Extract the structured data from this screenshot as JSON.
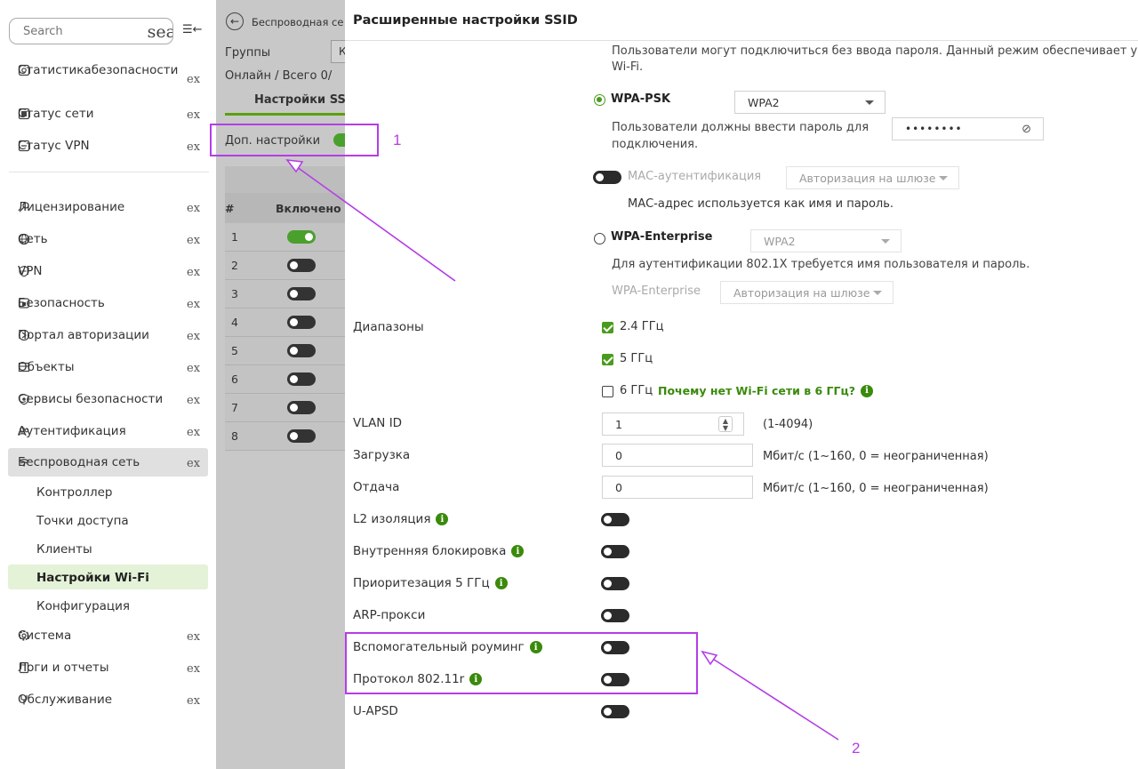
{
  "sidebar": {
    "search": {
      "placeholder": "Search",
      "value": "sea"
    },
    "collapse_icon": "collapse-left-icon",
    "ex_suffix": "ex",
    "top_items": [
      {
        "label1": "Статистика",
        "label2": "безопасности",
        "icon": "shield-stats-icon"
      },
      {
        "label": "Статус сети",
        "icon": "network-status-icon"
      },
      {
        "label": "Статус VPN",
        "icon": "vpn-status-icon"
      }
    ],
    "main_items": [
      {
        "label": "Лицензирование",
        "icon": "key-icon"
      },
      {
        "label": "Сеть",
        "icon": "globe-icon"
      },
      {
        "label": "VPN",
        "icon": "vpn-shield-icon"
      },
      {
        "label": "Безопасность",
        "icon": "lock-shield-icon"
      },
      {
        "label": "Портал авторизации",
        "icon": "portal-icon"
      },
      {
        "label": "Объекты",
        "icon": "objects-icon"
      },
      {
        "label": "Сервисы безопасности",
        "icon": "security-services-icon"
      },
      {
        "label": "Аутентификация",
        "icon": "users-icon"
      },
      {
        "label": "Беспроводная сеть",
        "icon": "wifi-icon"
      }
    ],
    "sub_items": [
      "Контроллер",
      "Точки доступа",
      "Клиенты",
      "Настройки Wi-Fi",
      "Конфигурация"
    ],
    "bottom_items": [
      {
        "label": "Система",
        "icon": "gear-icon"
      },
      {
        "label": "Логи и отчеты",
        "icon": "document-icon"
      },
      {
        "label": "Обслуживание",
        "icon": "wrench-icon"
      }
    ]
  },
  "middle": {
    "breadcrumb": "Беспроводная се",
    "groups_label": "Группы",
    "groups_value": "К",
    "online_label": "Онлайн / Всего  0/",
    "tab_label": "Настройки SSI",
    "adv_label": "Доп. настройки",
    "adv_enabled": true,
    "col_num": "#",
    "col_enabled": "Включено",
    "rows": [
      {
        "n": "1",
        "on": true
      },
      {
        "n": "2",
        "on": false
      },
      {
        "n": "3",
        "on": false
      },
      {
        "n": "4",
        "on": false
      },
      {
        "n": "5",
        "on": false
      },
      {
        "n": "6",
        "on": false
      },
      {
        "n": "7",
        "on": false
      },
      {
        "n": "8",
        "on": false
      }
    ]
  },
  "right": {
    "title": "Расширенные настройки SSID",
    "open_desc1": "Пользователи могут подключиться без ввода пароля. Данный режим обеспечивает у",
    "open_desc2": "Wi-Fi.",
    "wpa_psk_label": "WPA-PSK",
    "wpa_psk_select": "WPA2",
    "psk_desc1": "Пользователи должны ввести пароль для",
    "psk_desc2": "подключения.",
    "psk_password": "••••••••",
    "mac_label": "МАС-аутентификация",
    "mac_select": "Авторизация на шлюзе",
    "mac_desc": "МАС-адрес используется как имя и пароль.",
    "wpa_ent_label": "WPA-Enterprise",
    "wpa_ent_select": "WPA2",
    "ent_desc": "Для аутентификации 802.1X требуется имя пользователя и пароль.",
    "ent_sub_label": "WPA-Enterprise",
    "ent_sub_select": "Авторизация на шлюзе",
    "bands_label": "Диапазоны",
    "band_24": "2.4 ГГц",
    "band_5": "5 ГГц",
    "band_6": "6 ГГц",
    "band_6_link": "Почему нет Wi-Fi сети в 6 ГГц?",
    "bands_checked": {
      "b24": true,
      "b5": true,
      "b6": false
    },
    "vlan_label": "VLAN ID",
    "vlan_value": "1",
    "vlan_hint": "(1-4094)",
    "download_label": "Загрузка",
    "download_value": "0",
    "download_hint": "Мбит/с (1~160, 0 = неограниченная)",
    "upload_label": "Отдача",
    "upload_value": "0",
    "upload_hint": "Мбит/с (1~160, 0 = неограниченная)",
    "toggles": [
      {
        "label": "L2 изоляция",
        "info": true,
        "on": false
      },
      {
        "label": "Внутренняя блокировка",
        "info": true,
        "on": false
      },
      {
        "label": "Приоритезация 5 ГГц",
        "info": true,
        "on": false
      },
      {
        "label": "ARP-прокси",
        "info": false,
        "on": false
      },
      {
        "label": "Вспомогательный роуминг",
        "info": true,
        "on": false
      },
      {
        "label": "Протокол 802.11r",
        "info": true,
        "on": false
      },
      {
        "label": "U-APSD",
        "info": false,
        "on": false
      }
    ]
  },
  "annotations": {
    "label1": "1",
    "label2": "2",
    "color": "#b43de6"
  },
  "colors": {
    "accent": "#4a9b1c",
    "active_bg": "#e4f2d7",
    "overlay": "#c8c8c8"
  }
}
